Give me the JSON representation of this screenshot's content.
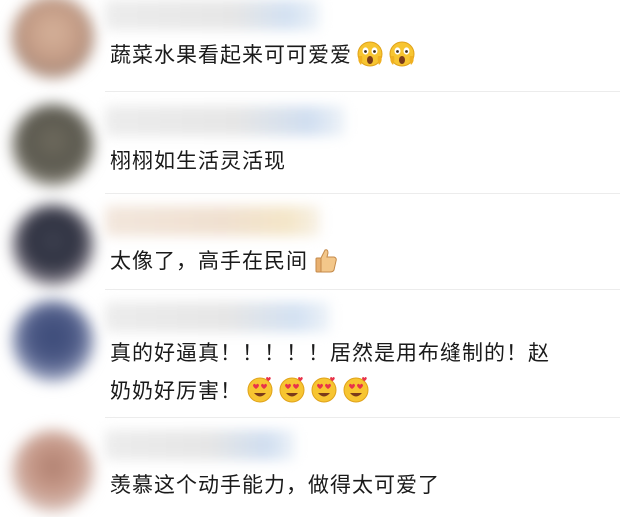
{
  "comments": [
    {
      "text": "蔬菜水果看起来可可爱爱",
      "emojis": [
        "scream-emoji",
        "scream-emoji"
      ]
    },
    {
      "text": "栩栩如生活灵活现",
      "emojis": []
    },
    {
      "text": "太像了，高手在民间",
      "emojis": [
        "thumbs-up-emoji"
      ]
    },
    {
      "text_line1": "真的好逼真！！！！！居然是用布缝制的！赵",
      "text_line2": "奶奶好厉害！",
      "emojis": [
        "heart-eyes-emoji",
        "heart-eyes-emoji",
        "heart-eyes-emoji",
        "heart-eyes-emoji"
      ]
    },
    {
      "text": "羡慕这个动手能力，做得太可爱了",
      "emojis": []
    }
  ],
  "colors": {
    "text": "#1a1a1a",
    "divider": "#ececec",
    "emoji_face": "#f7c531"
  }
}
